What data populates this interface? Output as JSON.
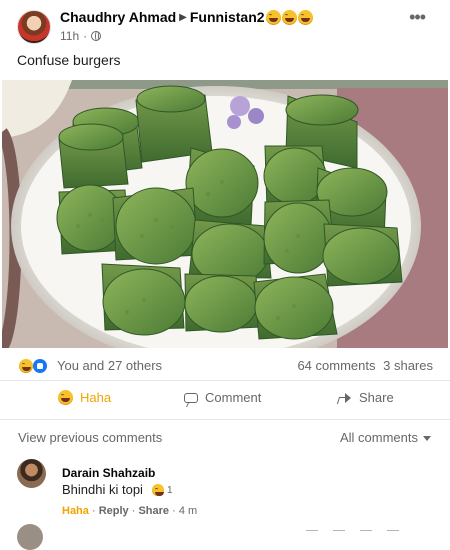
{
  "post": {
    "author": "Chaudhry Ahmad",
    "group": "Funnistan2",
    "time": "11h",
    "caption": "Confuse burgers",
    "header_emojis": [
      "laughing-emoji",
      "laughing-emoji",
      "laughing-emoji"
    ]
  },
  "reactions": {
    "summary": "You and 27 others",
    "comments": "64 comments",
    "shares": "3 shares"
  },
  "actions": {
    "haha_label": "Haha",
    "comment_label": "Comment",
    "share_label": "Share"
  },
  "comments_section": {
    "view_previous": "View previous comments",
    "filter": "All comments",
    "comment": {
      "name": "Darain Shahzaib",
      "text": "Bhindhi ki topi",
      "reaction_count": "1",
      "haha": "Haha",
      "reply": "Reply",
      "share": "Share",
      "time": "4 m"
    }
  },
  "colors": {
    "facebook_blue": "#1877f2",
    "haha_yellow": "#f0a400",
    "muted_text": "#65676b",
    "divider": "#e4e6eb"
  },
  "icons": [
    "more-icon",
    "globe-icon",
    "haha-icon",
    "comment-icon",
    "share-icon",
    "dropdown-icon"
  ]
}
